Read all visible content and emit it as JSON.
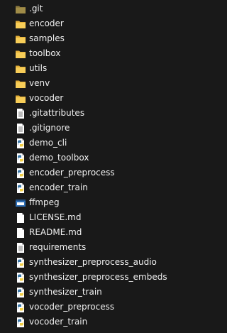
{
  "colors": {
    "background": "#191919",
    "text": "#f0f0f0",
    "folder": "#f7cd58",
    "folder_dark": "#e3ae37",
    "folder_hidden": "#8e7b3e",
    "doc_page": "#ffffff",
    "doc_lines": "#7a7a7a",
    "python_blue": "#3b78a8",
    "python_yellow": "#f2cf44",
    "exe_blue": "#2f6fb5"
  },
  "files": [
    {
      "name": ".git",
      "icon": "folder-hidden-icon"
    },
    {
      "name": "encoder",
      "icon": "folder-icon"
    },
    {
      "name": "samples",
      "icon": "folder-icon"
    },
    {
      "name": "toolbox",
      "icon": "folder-icon"
    },
    {
      "name": "utils",
      "icon": "folder-icon"
    },
    {
      "name": "venv",
      "icon": "folder-icon"
    },
    {
      "name": "vocoder",
      "icon": "folder-icon"
    },
    {
      "name": ".gitattributes",
      "icon": "text-file-icon"
    },
    {
      "name": ".gitignore",
      "icon": "text-file-icon"
    },
    {
      "name": "demo_cli",
      "icon": "python-file-icon"
    },
    {
      "name": "demo_toolbox",
      "icon": "python-file-icon"
    },
    {
      "name": "encoder_preprocess",
      "icon": "python-file-icon"
    },
    {
      "name": "encoder_train",
      "icon": "python-file-icon"
    },
    {
      "name": "ffmpeg",
      "icon": "executable-icon"
    },
    {
      "name": "LICENSE.md",
      "icon": "blank-file-icon"
    },
    {
      "name": "README.md",
      "icon": "blank-file-icon"
    },
    {
      "name": "requirements",
      "icon": "text-file-icon"
    },
    {
      "name": "synthesizer_preprocess_audio",
      "icon": "python-file-icon"
    },
    {
      "name": "synthesizer_preprocess_embeds",
      "icon": "python-file-icon"
    },
    {
      "name": "synthesizer_train",
      "icon": "python-file-icon"
    },
    {
      "name": "vocoder_preprocess",
      "icon": "python-file-icon"
    },
    {
      "name": "vocoder_train",
      "icon": "python-file-icon"
    }
  ]
}
